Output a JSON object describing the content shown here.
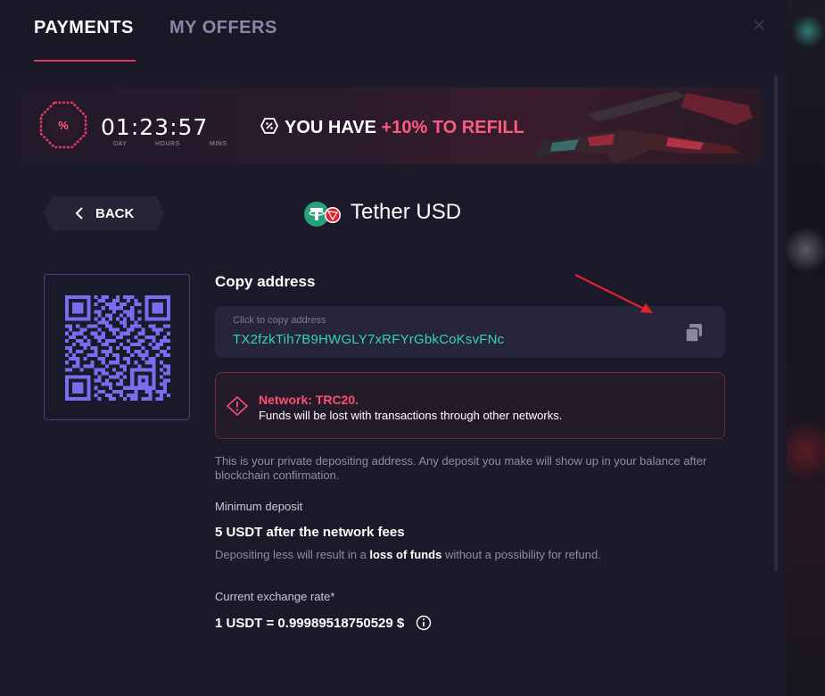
{
  "tabs": {
    "payments": "PAYMENTS",
    "offers": "MY OFFERS",
    "close_symbol": "×"
  },
  "banner": {
    "badge_symbol": "%",
    "timer": {
      "day": "01",
      "hours": "23",
      "mins": "57",
      "sep": ":"
    },
    "timer_labels": {
      "day": "DAY",
      "hours": "HOURS",
      "mins": "MINS"
    },
    "promo_prefix": "YOU HAVE",
    "promo_accent": "+10% TO REFILL"
  },
  "back_label": "BACK",
  "coin": {
    "name": "Tether USD",
    "icon": "tether-tron-icon"
  },
  "copy": {
    "heading": "Copy address",
    "hint": "Click to copy address",
    "address": "TX2fzkTih7B9HWGLY7xRFYrGbkCoKsvFNc"
  },
  "warning": {
    "title": "Network: TRC20.",
    "text": "Funds will be lost with transactions through other networks."
  },
  "info": "This is your private depositing address. Any deposit you make will show up in your balance after blockchain confirmation.",
  "minimum": {
    "label": "Minimum deposit",
    "value": "5 USDT after the network fees",
    "note_prefix": "Depositing less will result in a",
    "note_bold": "loss of funds",
    "note_suffix": "without a possibility for refund."
  },
  "rate": {
    "label": "Current exchange rate*",
    "value": "1 USDT = 0.99989518750529 $"
  },
  "colors": {
    "accent_pink": "#e8365f",
    "address_green": "#2fd6b5",
    "warning_red": "#ff4d73",
    "qr_purple": "#7a6cf0"
  }
}
